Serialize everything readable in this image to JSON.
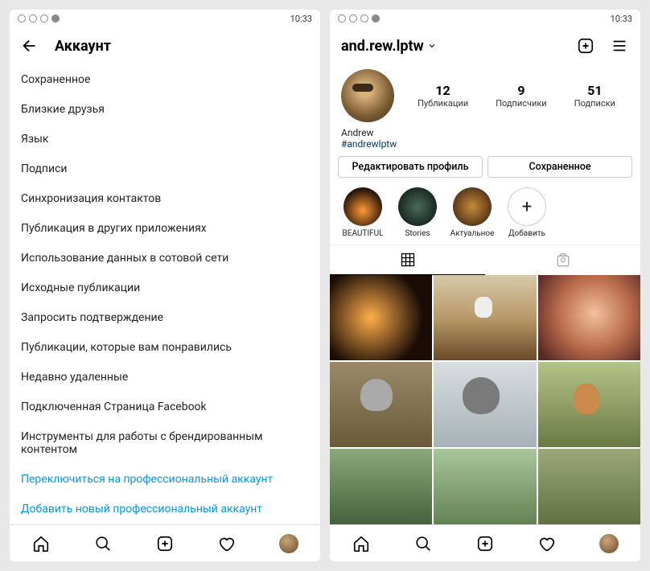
{
  "statusbar": {
    "time": "10:33"
  },
  "left": {
    "header_title": "Аккаунт",
    "items": [
      "Сохраненное",
      "Близкие друзья",
      "Язык",
      "Подписи",
      "Синхронизация контактов",
      "Публикация в других приложениях",
      "Использование данных в сотовой сети",
      "Исходные публикации",
      "Запросить подтверждение",
      "Публикации, которые вам понравились",
      "Недавно удаленные",
      "Подключенная Страница Facebook",
      "Инструменты для работы с брендированным контентом"
    ],
    "link_items": [
      "Переключиться на профессиональный аккаунт",
      "Добавить новый профессиональный аккаунт"
    ]
  },
  "right": {
    "username": "and.rew.lptw",
    "stats": {
      "posts": {
        "count": "12",
        "label": "Публикации"
      },
      "followers": {
        "count": "9",
        "label": "Подписчики"
      },
      "following": {
        "count": "51",
        "label": "Подписки"
      }
    },
    "bio": {
      "name": "Andrew",
      "tag": "#andrewlptw"
    },
    "buttons": {
      "edit": "Редактировать профиль",
      "saved": "Сохраненное"
    },
    "highlights": [
      {
        "label": "BEAUTIFUL"
      },
      {
        "label": "Stories"
      },
      {
        "label": "Актуальное"
      },
      {
        "label": "Добавить"
      }
    ]
  }
}
